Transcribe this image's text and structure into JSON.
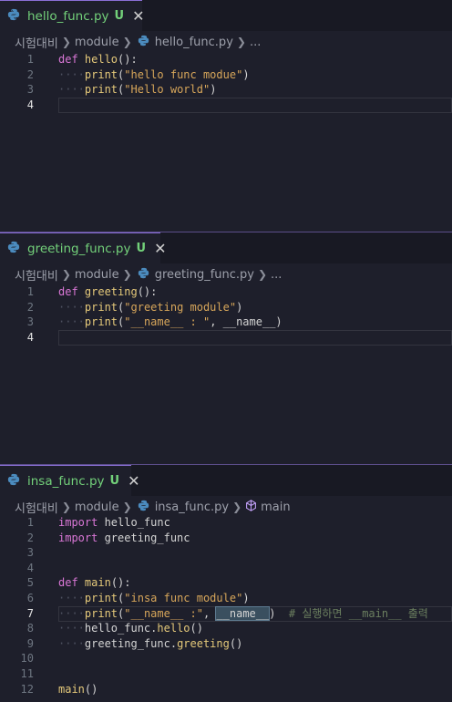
{
  "panes": [
    {
      "tab": {
        "name": "hello_func.py",
        "status": "U",
        "close": "✕"
      },
      "breadcrumb": {
        "folder": "시험대비",
        "module": "module",
        "file": "hello_func.py",
        "rest": "..."
      },
      "lines": [
        {
          "num": "1",
          "indent": "",
          "parts": [
            [
              "kw",
              "def "
            ],
            [
              "fn",
              "hello"
            ],
            [
              "plain",
              "():"
            ]
          ]
        },
        {
          "num": "2",
          "indent": "····",
          "parts": [
            [
              "fn",
              "print"
            ],
            [
              "plain",
              "("
            ],
            [
              "str",
              "\"hello func modue\""
            ],
            [
              "plain",
              ")"
            ]
          ]
        },
        {
          "num": "3",
          "indent": "····",
          "parts": [
            [
              "fn",
              "print"
            ],
            [
              "plain",
              "("
            ],
            [
              "str",
              "\"Hello world\""
            ],
            [
              "plain",
              ")"
            ]
          ]
        },
        {
          "num": "4",
          "indent": "",
          "parts": [],
          "active": true
        }
      ]
    },
    {
      "tab": {
        "name": "greeting_func.py",
        "status": "U",
        "close": "✕"
      },
      "breadcrumb": {
        "folder": "시험대비",
        "module": "module",
        "file": "greeting_func.py",
        "rest": "..."
      },
      "lines": [
        {
          "num": "1",
          "indent": "",
          "parts": [
            [
              "kw",
              "def "
            ],
            [
              "fn",
              "greeting"
            ],
            [
              "plain",
              "():"
            ]
          ]
        },
        {
          "num": "2",
          "indent": "····",
          "parts": [
            [
              "fn",
              "print"
            ],
            [
              "plain",
              "("
            ],
            [
              "str",
              "\"greeting module\""
            ],
            [
              "plain",
              ")"
            ]
          ]
        },
        {
          "num": "3",
          "indent": "····",
          "parts": [
            [
              "fn",
              "print"
            ],
            [
              "plain",
              "("
            ],
            [
              "str",
              "\"__name__ : \""
            ],
            [
              "plain",
              ", __name__)"
            ]
          ]
        },
        {
          "num": "4",
          "indent": "",
          "parts": [],
          "active": true
        }
      ]
    },
    {
      "tab": {
        "name": "insa_func.py",
        "status": "U",
        "close": "✕"
      },
      "breadcrumb": {
        "folder": "시험대비",
        "module": "module",
        "file": "insa_func.py",
        "rest": "main"
      },
      "lines": [
        {
          "num": "1",
          "indent": "",
          "parts": [
            [
              "kw",
              "import "
            ],
            [
              "plain",
              "hello_func"
            ]
          ]
        },
        {
          "num": "2",
          "indent": "",
          "parts": [
            [
              "kw",
              "import "
            ],
            [
              "plain",
              "greeting_func"
            ]
          ]
        },
        {
          "num": "3",
          "indent": "",
          "parts": []
        },
        {
          "num": "4",
          "indent": "",
          "parts": []
        },
        {
          "num": "5",
          "indent": "",
          "parts": [
            [
              "kw",
              "def "
            ],
            [
              "fn",
              "main"
            ],
            [
              "plain",
              "():"
            ]
          ]
        },
        {
          "num": "6",
          "indent": "····",
          "parts": [
            [
              "fn",
              "print"
            ],
            [
              "plain",
              "("
            ],
            [
              "str",
              "\"insa func module\""
            ],
            [
              "plain",
              ")"
            ]
          ]
        },
        {
          "num": "7",
          "indent": "····",
          "parts": [
            [
              "fn",
              "print"
            ],
            [
              "plain",
              "("
            ],
            [
              "str",
              "\"__name__ :\""
            ],
            [
              "plain",
              ", "
            ],
            [
              "hl",
              "__name__"
            ],
            [
              "plain",
              ")  "
            ],
            [
              "cm",
              "# 실행하면 __main__ 출력"
            ]
          ],
          "active": true
        },
        {
          "num": "8",
          "indent": "····",
          "parts": [
            [
              "plain",
              "hello_func."
            ],
            [
              "fn",
              "hello"
            ],
            [
              "plain",
              "()"
            ]
          ]
        },
        {
          "num": "9",
          "indent": "····",
          "parts": [
            [
              "plain",
              "greeting_func."
            ],
            [
              "fn",
              "greeting"
            ],
            [
              "plain",
              "()"
            ]
          ]
        },
        {
          "num": "10",
          "indent": "",
          "parts": []
        },
        {
          "num": "11",
          "indent": "",
          "parts": []
        },
        {
          "num": "12",
          "indent": "",
          "parts": [
            [
              "fn",
              "main"
            ],
            [
              "plain",
              "()"
            ]
          ]
        }
      ]
    }
  ],
  "icons": {
    "file": "python-file-icon",
    "symbol": "method-cube-icon"
  },
  "colors": {
    "accent": "#8a6fd6",
    "untracked": "#73d17a",
    "keyword": "#d977d6",
    "function": "#e5c97a",
    "string": "#d7a65a"
  }
}
